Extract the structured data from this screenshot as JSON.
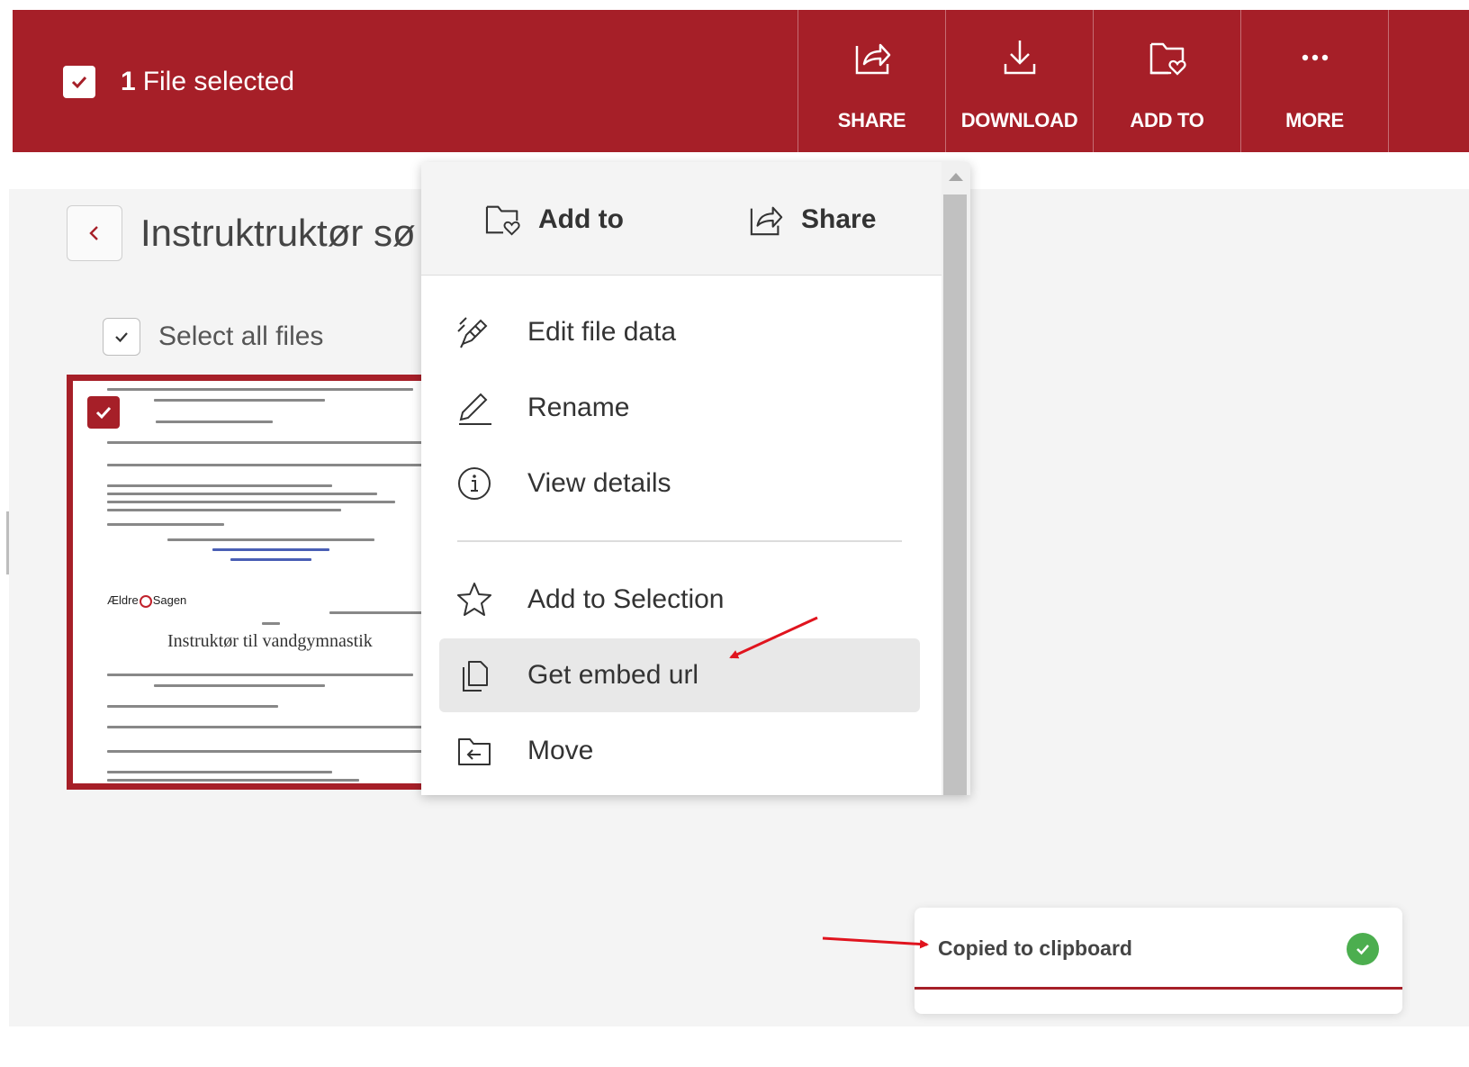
{
  "selection_bar": {
    "count": "1",
    "label": "File selected",
    "actions": [
      {
        "label": "SHARE",
        "icon": "share-icon"
      },
      {
        "label": "DOWNLOAD",
        "icon": "download-icon"
      },
      {
        "label": "ADD TO",
        "icon": "folder-heart-icon"
      },
      {
        "label": "MORE",
        "icon": "more-icon"
      }
    ],
    "color": "#a61f28"
  },
  "folder": {
    "title": "Instruktruktør sø"
  },
  "select_all": {
    "label": "Select all files",
    "checked": true
  },
  "thumbnail": {
    "selected": true,
    "doc_title": "Instruktør til vandgymnastik",
    "logo_text_a": "Ældre",
    "logo_text_b": "Sagen"
  },
  "context_menu": {
    "header": [
      {
        "label": "Add to",
        "icon": "folder-heart-icon"
      },
      {
        "label": "Share",
        "icon": "share-icon"
      }
    ],
    "items": [
      {
        "label": "Edit file data",
        "icon": "edit-data-icon"
      },
      {
        "label": "Rename",
        "icon": "pencil-icon"
      },
      {
        "label": "View details",
        "icon": "info-icon"
      },
      {
        "label": "Add to Selection",
        "icon": "star-icon"
      },
      {
        "label": "Get embed url",
        "icon": "copy-icon",
        "highlighted": true
      },
      {
        "label": "Move",
        "icon": "folder-move-icon"
      }
    ]
  },
  "toast": {
    "message": "Copied to clipboard",
    "status_color": "#4cae4f"
  }
}
